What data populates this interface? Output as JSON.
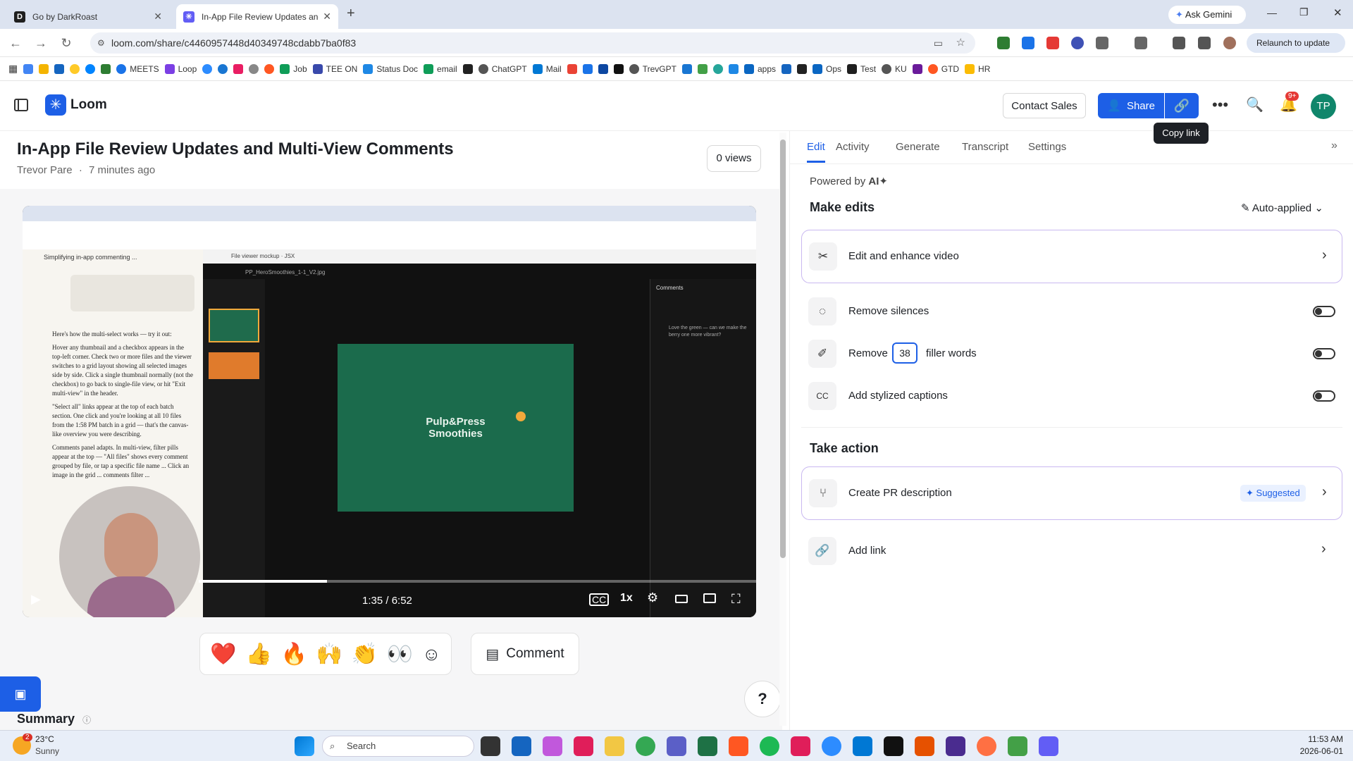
{
  "browser": {
    "tabs": [
      {
        "title": "Go by DarkRoast",
        "favicon": "D",
        "favicon_color": "#1f1f1f"
      },
      {
        "title": "In-App File Review Updates and",
        "favicon": "✳",
        "favicon_color": "#625df5"
      }
    ],
    "new_tab": "+",
    "gemini_label": "Ask Gemini",
    "url": "loom.com/share/c4460957448d40349748cdabb7ba0f83",
    "relaunch_label": "Relaunch to update",
    "bookmarks": [
      "MEETS",
      "Loop",
      "Job",
      "TEE ON",
      "Status Doc",
      "email",
      "ChatGPT",
      "Mail",
      "TrevGPT",
      "apps",
      "Ops",
      "Test",
      "KU",
      "GTD",
      "HR"
    ]
  },
  "loom": {
    "brand": "Loom",
    "contact_sales": "Contact Sales",
    "share": "Share",
    "copy_link_tooltip": "Copy link",
    "notif_badge": "9+",
    "avatar_initials": "TP",
    "accent": "#1d5fe6"
  },
  "video": {
    "title": "In-App File Review Updates and Multi-View Comments",
    "author": "Trevor Pare",
    "time_ago": "7 minutes ago",
    "views": "0 views",
    "timestamp": "1:35 / 6:52",
    "speed": "1x",
    "slide_title": "Pulp&Press\nSmoothies",
    "progress_fraction": 0.23,
    "inner_chat_heading": "Simplifying in-app commenting ...",
    "inner_viewer_label": "File viewer mockup · JSX",
    "inner_file": "PP_HeroSmoothies_1-1_V2.jpg",
    "inner_comments_header": "Comments",
    "inner_comment_text": "Love the green — can we make the berry one more vibrant?",
    "inner_body_1": "Here's how the multi-select works — try it out:",
    "inner_body_2": "Hover any thumbnail and a checkbox appears in the top-left corner. Check two or more files and the viewer switches to a grid layout showing all selected images side by side. Click a single thumbnail normally (not the checkbox) to go back to single-file view, or hit \"Exit multi-view\" in the header.",
    "inner_body_3": "\"Select all\" links appear at the top of each batch section. One click and you're looking at all 10 files from the 1:58 PM batch in a grid — that's the canvas-like overview you were describing.",
    "inner_body_4": "Comments panel adapts. In multi-view, filter pills appear at the top — \"All files\" shows every comment grouped by file, or tap a specific file name ... Click an image in the grid ... comments filter ..."
  },
  "reactions": [
    "❤️",
    "👍",
    "🔥",
    "🙌",
    "👏",
    "👀"
  ],
  "comment_label": "Comment",
  "summary_label": "Summary",
  "help_label": "?",
  "panel": {
    "tabs": [
      "Edit",
      "Activity",
      "Generate",
      "Transcript",
      "Settings"
    ],
    "powered_by": "Powered by",
    "ai": "AI",
    "make_edits": "Make edits",
    "auto_applied": "Auto-applied",
    "edit_enhance": "Edit and enhance video",
    "remove_silences": "Remove silences",
    "remove": "Remove",
    "filler_count": "38",
    "filler_words": "filler words",
    "captions": "Add stylized captions",
    "take_action": "Take action",
    "create_pr": "Create PR description",
    "suggested": "Suggested",
    "add_link": "Add link"
  },
  "taskbar": {
    "temp": "23°C",
    "weather": "Sunny",
    "weather_badge": "2",
    "search": "Search",
    "time": "11:53 AM",
    "date": "2026-06-01"
  }
}
